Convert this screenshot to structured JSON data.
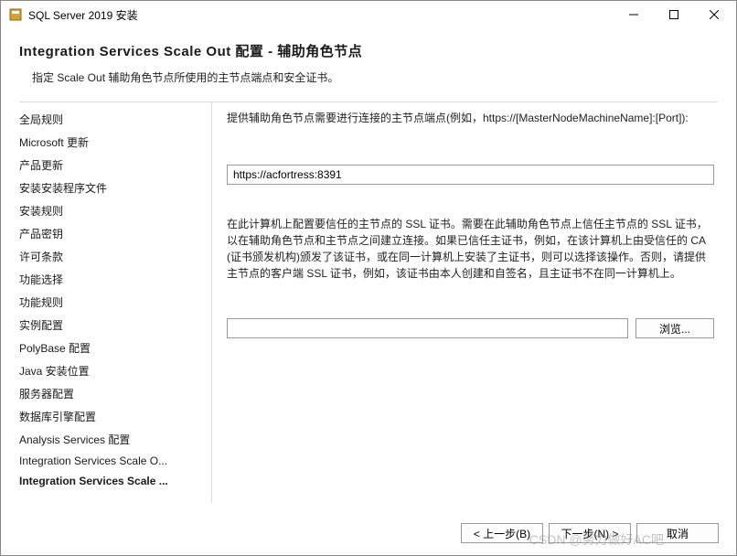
{
  "window": {
    "title": "SQL Server 2019 安装"
  },
  "header": {
    "title": "Integration  Services  Scale  Out 配置 - 辅助角色节点",
    "subtitle": "指定 Scale Out 辅助角色节点所使用的主节点端点和安全证书。"
  },
  "sidebar": {
    "items": [
      {
        "label": "全局规则"
      },
      {
        "label": "Microsoft 更新"
      },
      {
        "label": "产品更新"
      },
      {
        "label": "安装安装程序文件"
      },
      {
        "label": "安装规则"
      },
      {
        "label": "产品密钥"
      },
      {
        "label": "许可条款"
      },
      {
        "label": "功能选择"
      },
      {
        "label": "功能规则"
      },
      {
        "label": "实例配置"
      },
      {
        "label": "PolyBase 配置"
      },
      {
        "label": "Java 安装位置"
      },
      {
        "label": "服务器配置"
      },
      {
        "label": "数据库引擎配置"
      },
      {
        "label": "Analysis Services 配置"
      },
      {
        "label": "Integration Services Scale O..."
      },
      {
        "label": "Integration Services Scale ...",
        "active": true
      }
    ]
  },
  "main": {
    "endpoint_label": "提供辅助角色节点需要进行连接的主节点端点(例如，https://[MasterNodeMachineName]:[Port]):",
    "endpoint_value": "https://acfortress:8391",
    "ssl_desc": "在此计算机上配置要信任的主节点的 SSL 证书。需要在此辅助角色节点上信任主节点的 SSL 证书，以在辅助角色节点和主节点之间建立连接。如果已信任主证书，例如，在该计算机上由受信任的 CA (证书颁发机构)颁发了该证书，或在同一计算机上安装了主证书，则可以选择该操作。否则，请提供主节点的客户端 SSL 证书，例如，该证书由本人创建和自签名，且主证书不在同一计算机上。",
    "cert_value": "",
    "browse_label": "浏览..."
  },
  "footer": {
    "back": "< 上一步(B)",
    "next": "下一步(N) >",
    "cancel": "取消"
  },
  "watermark": "CSDN @努力做好AC吧"
}
